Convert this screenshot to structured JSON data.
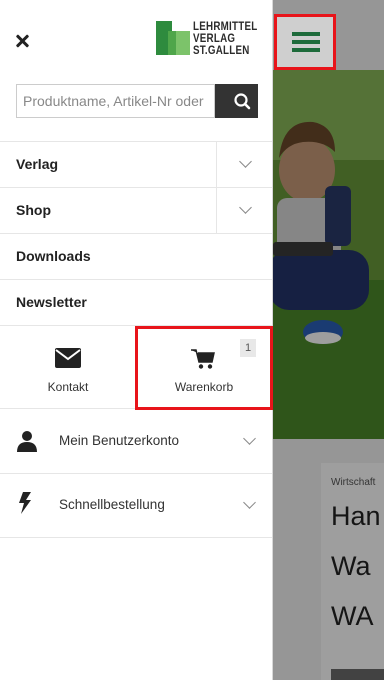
{
  "logo": {
    "line1": "LEHRMITTEL",
    "line2": "VERLAG",
    "line3": "ST.GALLEN",
    "green_dark": "#2e8b3e",
    "green_light": "#7cc36a"
  },
  "search": {
    "placeholder": "Produktname, Artikel-Nr oder Stichwort",
    "value": ""
  },
  "nav": [
    {
      "label": "Verlag",
      "expandable": true
    },
    {
      "label": "Shop",
      "expandable": true
    },
    {
      "label": "Downloads",
      "expandable": false
    },
    {
      "label": "Newsletter",
      "expandable": false
    }
  ],
  "quick": {
    "contact_label": "Kontakt",
    "cart_label": "Warenkorb",
    "cart_count": "1"
  },
  "account": {
    "label": "Mein Benutzerkonto"
  },
  "quickorder": {
    "label": "Schnellbestellung"
  },
  "page": {
    "category": "Wirtschaft",
    "title_line1": "Han",
    "title_line2": "Wa",
    "title_line3": "WA"
  },
  "colors": {
    "accent_green": "#1e6b3b",
    "highlight_red": "#e8141a"
  }
}
